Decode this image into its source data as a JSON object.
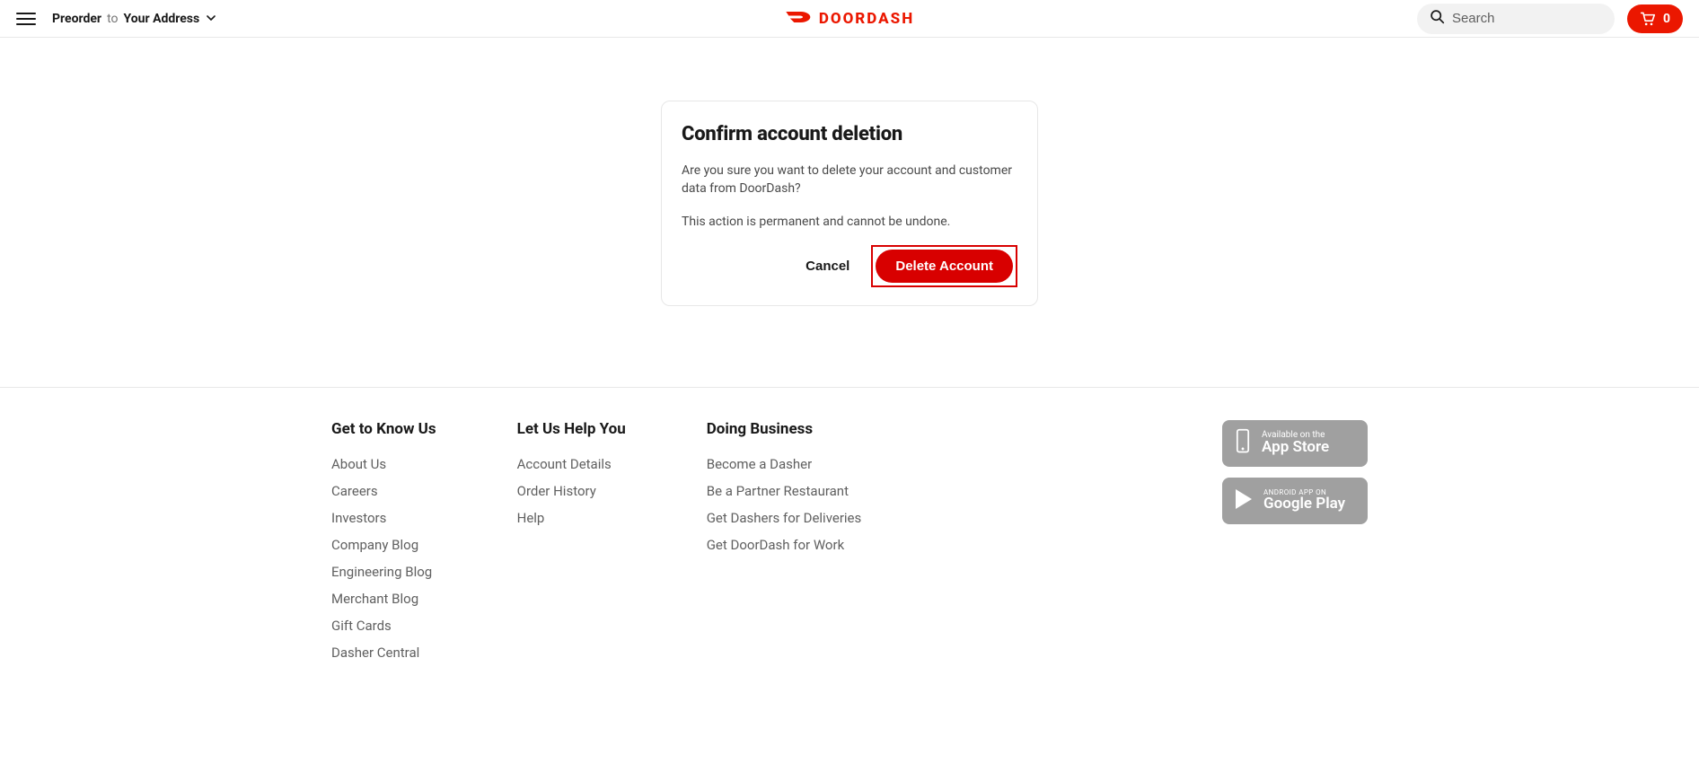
{
  "header": {
    "preorder_label": "Preorder",
    "to_label": "to",
    "address_label": "Your Address",
    "brand_name": "DOORDASH",
    "search_placeholder": "Search",
    "cart_count": "0"
  },
  "modal": {
    "title": "Confirm account deletion",
    "body1": "Are you sure you want to delete your account and customer data from DoorDash?",
    "body2": "This action is permanent and cannot be undone.",
    "cancel_label": "Cancel",
    "delete_label": "Delete Account"
  },
  "footer": {
    "cols": [
      {
        "heading": "Get to Know Us",
        "links": [
          "About Us",
          "Careers",
          "Investors",
          "Company Blog",
          "Engineering Blog",
          "Merchant Blog",
          "Gift Cards",
          "Dasher Central"
        ]
      },
      {
        "heading": "Let Us Help You",
        "links": [
          "Account Details",
          "Order History",
          "Help"
        ]
      },
      {
        "heading": "Doing Business",
        "links": [
          "Become a Dasher",
          "Be a Partner Restaurant",
          "Get Dashers for Deliveries",
          "Get DoorDash for Work"
        ]
      }
    ],
    "appstore": {
      "small": "Available on the",
      "big": "App Store"
    },
    "playstore": {
      "small": "ANDROID APP ON",
      "big": "Google Play"
    }
  }
}
